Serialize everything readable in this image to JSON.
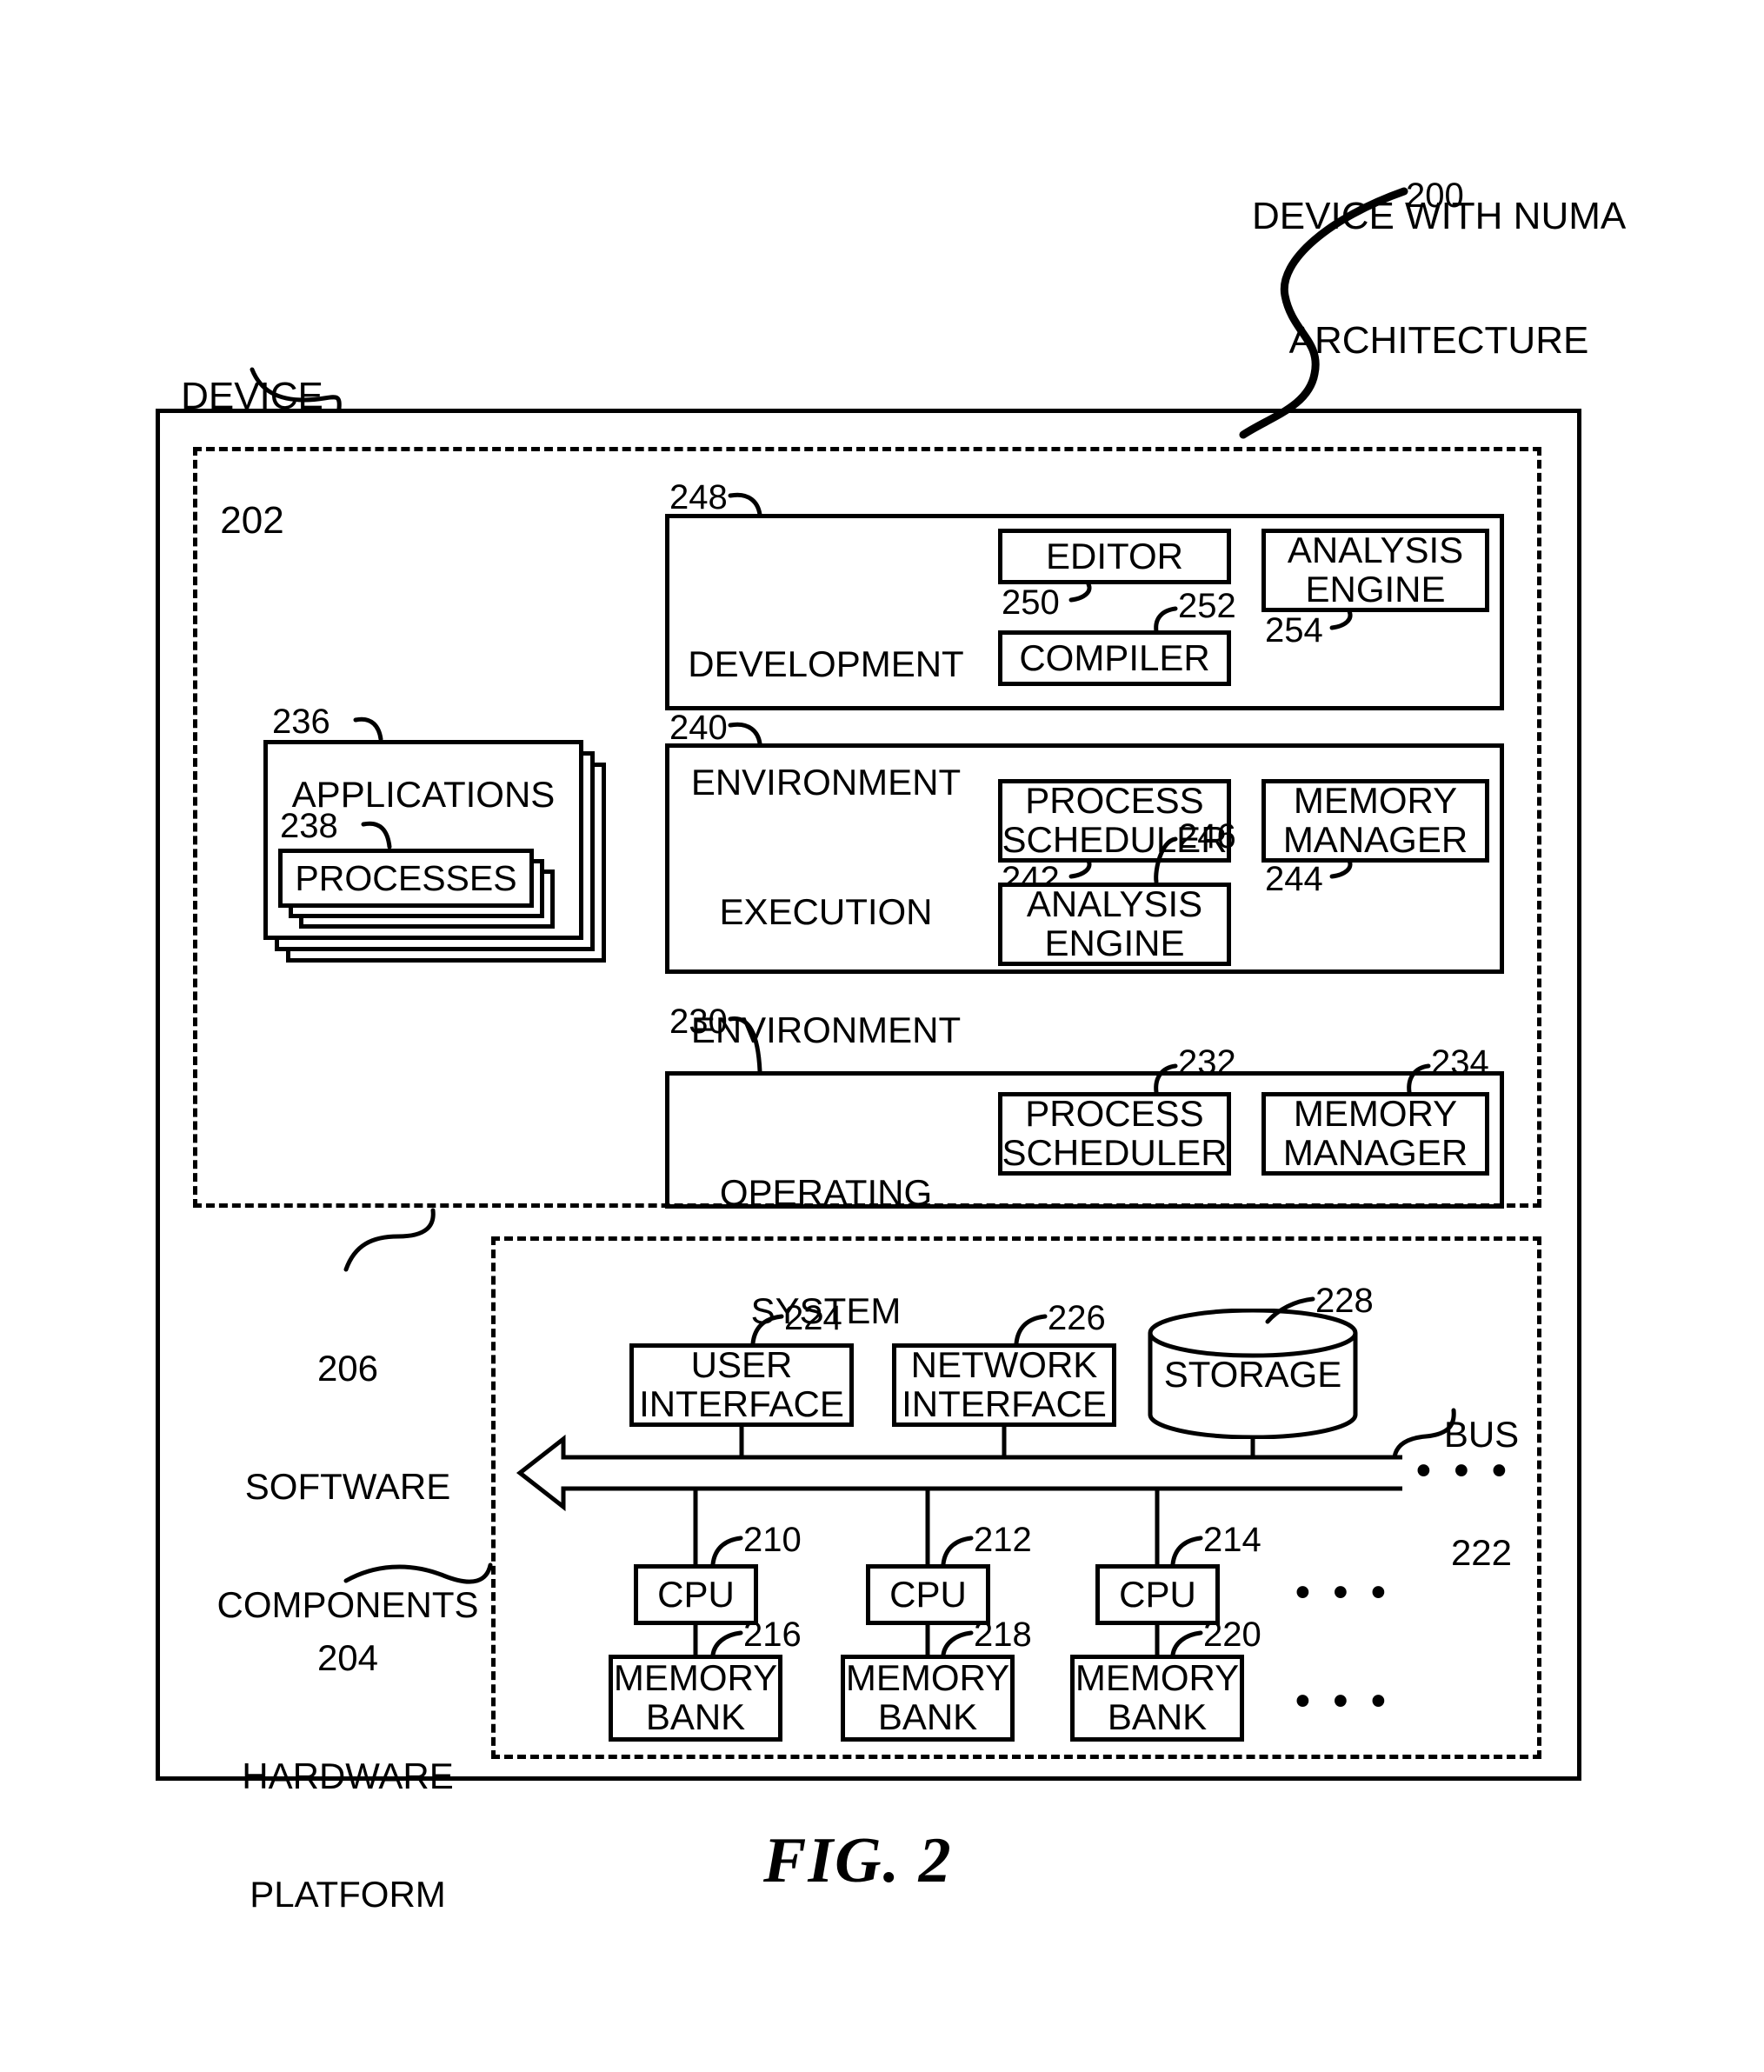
{
  "figure": {
    "caption": "FIG. 2",
    "title_top": "DEVICE WITH NUMA ARCHITECTURE",
    "title_top_line1": "DEVICE WITH NUMA",
    "title_top_line2": "ARCHITECTURE",
    "title_top_ref": "200"
  },
  "device": {
    "label_line1": "DEVICE",
    "label_line2": "202"
  },
  "software_components": {
    "ref": "206",
    "label_line1": "SOFTWARE",
    "label_line2": "COMPONENTS"
  },
  "hardware_platform": {
    "ref": "204",
    "label_line1": "HARDWARE",
    "label_line2": "PLATFORM"
  },
  "development_environment": {
    "ref": "248",
    "label_line1": "DEVELOPMENT",
    "label_line2": "ENVIRONMENT",
    "children": [
      {
        "label": "EDITOR",
        "ref": "250"
      },
      {
        "label": "COMPILER",
        "ref": "252"
      },
      {
        "label_line1": "ANALYSIS",
        "label_line2": "ENGINE",
        "ref": "254"
      }
    ]
  },
  "execution_environment": {
    "ref": "240",
    "label_line1": "EXECUTION",
    "label_line2": "ENVIRONMENT",
    "children": [
      {
        "label_line1": "PROCESS",
        "label_line2": "SCHEDULER",
        "ref": "242"
      },
      {
        "label_line1": "ANALYSIS",
        "label_line2": "ENGINE",
        "ref": "246"
      },
      {
        "label_line1": "MEMORY",
        "label_line2": "MANAGER",
        "ref": "244"
      }
    ]
  },
  "operating_system": {
    "ref": "230",
    "label_line1": "OPERATING",
    "label_line2": "SYSTEM",
    "children": [
      {
        "label_line1": "PROCESS",
        "label_line2": "SCHEDULER",
        "ref": "232"
      },
      {
        "label_line1": "MEMORY",
        "label_line2": "MANAGER",
        "ref": "234"
      }
    ]
  },
  "applications": {
    "ref": "236",
    "label": "APPLICATIONS",
    "processes": {
      "ref": "238",
      "label": "PROCESSES"
    }
  },
  "hardware": {
    "peripherals": [
      {
        "label_line1": "USER",
        "label_line2": "INTERFACE",
        "ref": "224"
      },
      {
        "label_line1": "NETWORK",
        "label_line2": "INTERFACE",
        "ref": "226"
      },
      {
        "label": "STORAGE",
        "ref": "228",
        "shape": "cylinder"
      }
    ],
    "bus": {
      "label_line1": "BUS",
      "label_line2": "222",
      "ellipsis": "•  •  •"
    },
    "cpus": [
      {
        "label": "CPU",
        "ref": "210"
      },
      {
        "label": "CPU",
        "ref": "212"
      },
      {
        "label": "CPU",
        "ref": "214"
      }
    ],
    "cpu_ellipsis": "•  •  •",
    "memory_banks": [
      {
        "label_line1": "MEMORY",
        "label_line2": "BANK",
        "ref": "216"
      },
      {
        "label_line1": "MEMORY",
        "label_line2": "BANK",
        "ref": "218"
      },
      {
        "label_line1": "MEMORY",
        "label_line2": "BANK",
        "ref": "220"
      }
    ],
    "memory_ellipsis": "•  •  •"
  },
  "colors": {
    "ink": "#000000",
    "paper": "#ffffff"
  }
}
